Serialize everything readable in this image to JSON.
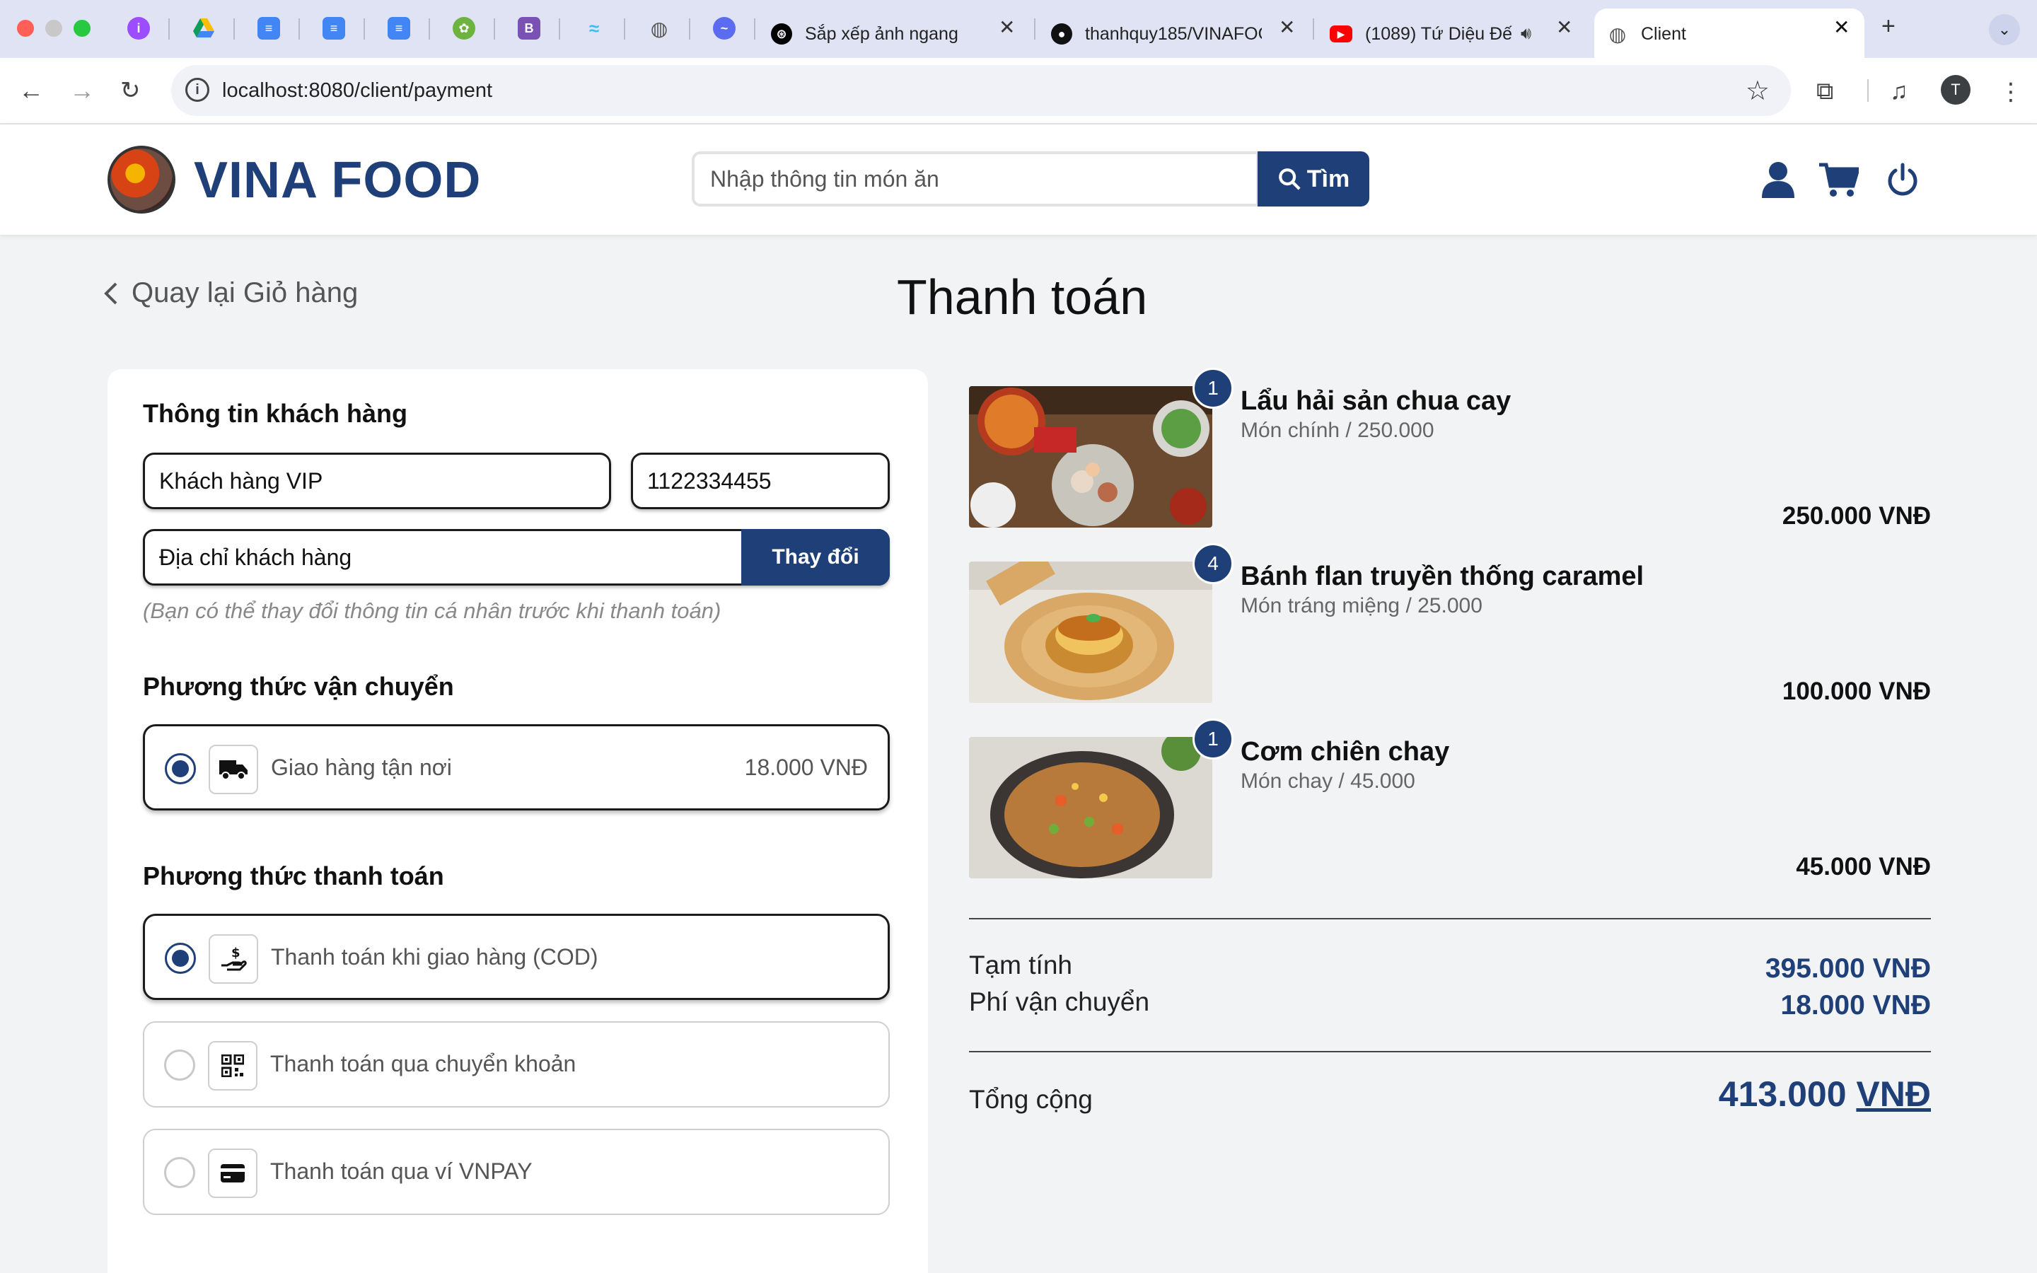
{
  "browser": {
    "tabs": [
      {
        "title": "Sắp xếp ảnh ngang"
      },
      {
        "title": "thanhquy185/VINAFOOD"
      },
      {
        "title": "(1089) Tứ Diệu Đế"
      },
      {
        "title": "Client"
      }
    ],
    "url": "localhost:8080/client/payment",
    "profile_initial": "T"
  },
  "header": {
    "brand": "VINA FOOD",
    "search_placeholder": "Nhập thông tin món ăn",
    "search_button": "Tìm"
  },
  "page": {
    "back_label": "Quay lại Giỏ hàng",
    "title": "Thanh toán"
  },
  "customer": {
    "section_title": "Thông tin khách hàng",
    "name": "Khách hàng VIP",
    "phone": "1122334455",
    "address": "Địa chỉ khách hàng",
    "change_button": "Thay đổi",
    "note": "(Bạn có thể thay đổi thông tin cá nhân trước khi thanh toán)"
  },
  "shipping": {
    "section_title": "Phương thức vận chuyển",
    "options": [
      {
        "label": "Giao hàng tận nơi",
        "price": "18.000 VNĐ",
        "selected": true,
        "icon": "truck-icon"
      }
    ]
  },
  "payment": {
    "section_title": "Phương thức thanh toán",
    "options": [
      {
        "label": "Thanh toán khi giao hàng (COD)",
        "selected": true,
        "icon": "cash-hand-icon"
      },
      {
        "label": "Thanh toán qua chuyển khoản",
        "selected": false,
        "icon": "qr-code-icon"
      },
      {
        "label": "Thanh toán qua ví VNPAY",
        "selected": false,
        "icon": "credit-card-icon"
      }
    ]
  },
  "items": [
    {
      "qty": "1",
      "name": "Lẩu hải sản chua cay",
      "sub": "Món chính / 250.000",
      "total": "250.000 VNĐ"
    },
    {
      "qty": "4",
      "name": "Bánh flan truyền thống caramel",
      "sub": "Món tráng miệng / 25.000",
      "total": "100.000 VNĐ"
    },
    {
      "qty": "1",
      "name": "Cơm chiên chay",
      "sub": "Món chay / 45.000",
      "total": "45.000 VNĐ"
    }
  ],
  "summary": {
    "subtotal_label": "Tạm tính",
    "subtotal_value": "395.000 VNĐ",
    "shipping_label": "Phí vận chuyển",
    "shipping_value": "18.000 VNĐ",
    "total_label": "Tổng cộng",
    "total_amount": "413.000",
    "total_unit": "VNĐ"
  },
  "colors": {
    "primary": "#1e3f78",
    "page_bg": "#f1f3f4"
  }
}
